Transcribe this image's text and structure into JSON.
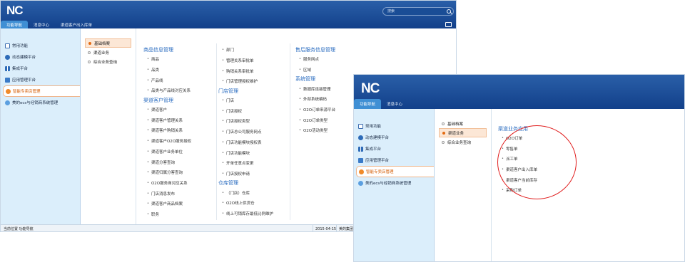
{
  "brand": "NC",
  "search": {
    "placeholder": "搜索"
  },
  "window_a": {
    "tabs": [
      "功能导航",
      "消息中心",
      "渠道客户出入库单"
    ],
    "sidebar": [
      {
        "label": "常用功能",
        "icon": "doc-icon"
      },
      {
        "label": "动态建模平台",
        "icon": "gear-icon"
      },
      {
        "label": "集成平台",
        "icon": "grid-icon"
      },
      {
        "label": "应用管理平台",
        "icon": "app-icon"
      },
      {
        "label": "智能专卖店管理",
        "icon": "shop-icon",
        "active": true
      },
      {
        "label": "美的ecs与经销商系统管理",
        "icon": "globe-icon"
      }
    ],
    "subnav": [
      "基础档案",
      "渠道业务",
      "综合业务查询"
    ],
    "columns": {
      "c1": {
        "sections": [
          {
            "title": "商品信息管理",
            "items": [
              "商品",
              "品类",
              "产品线",
              "品类与产品线对应关系"
            ]
          },
          {
            "title": "渠道客户管理",
            "items": [
              "渠道客户",
              "渠道客户管理关系",
              "渠道客户购销关系",
              "渠道客户O2O服务授权",
              "渠道客户业务单位",
              "渠道分客查询",
              "渠道归属分客查询",
              "O2O服务商对应关系",
              "门店消息发布",
              "渠道客户商品档案",
              "职务"
            ]
          }
        ]
      },
      "c2": {
        "top": [
          "部门",
          "管理关系审批单",
          "购销关系审批单",
          "门店管理授权维护"
        ],
        "sections": [
          {
            "title": "门店管理",
            "items": [
              "门店",
              "门店授权",
              "门店授权类型",
              "门店总公司服务网点",
              "门店功能模块授权表",
              "门店功能模块",
              "开单任意点变更",
              "门店授权申请"
            ]
          },
          {
            "title": "仓库管理",
            "items": [
              "（门店）仓库",
              "O2O线上供货仓",
              "线上可销库存最低比例维护"
            ]
          }
        ]
      },
      "c3": {
        "sections": [
          {
            "title": "售后服务信息管理",
            "items": [
              "服务网点",
              "区域"
            ]
          },
          {
            "title": "系统管理",
            "items": [
              "数据库连接管理",
              "外部系统编码",
              "O2O订单来源平台",
              "O2O订单类型",
              "O2O活动类型"
            ]
          }
        ]
      }
    },
    "status": {
      "location": "当前位置 功能导航",
      "date": "2015-04-15",
      "user": "美的集团"
    }
  },
  "window_b": {
    "tabs": [
      "功能导航",
      "消息中心"
    ],
    "sidebar": [
      {
        "label": "常用功能",
        "icon": "doc-icon"
      },
      {
        "label": "动态建模平台",
        "icon": "gear-icon"
      },
      {
        "label": "集成平台",
        "icon": "grid-icon"
      },
      {
        "label": "应用管理平台",
        "icon": "app-icon"
      },
      {
        "label": "智能专卖店管理",
        "icon": "shop-icon",
        "active": true
      },
      {
        "label": "美的ecs与经销商系统管理",
        "icon": "globe-icon"
      }
    ],
    "subnav": [
      "基础档案",
      "渠道业务",
      "综合业务查询"
    ],
    "section_title": "渠道业务应用",
    "items": [
      "O2O订单",
      "零售单",
      "派工单",
      "渠道客户出入库单",
      "渠道客户当前库存",
      "采购订单"
    ]
  },
  "annotation_color": "#e01d1d"
}
